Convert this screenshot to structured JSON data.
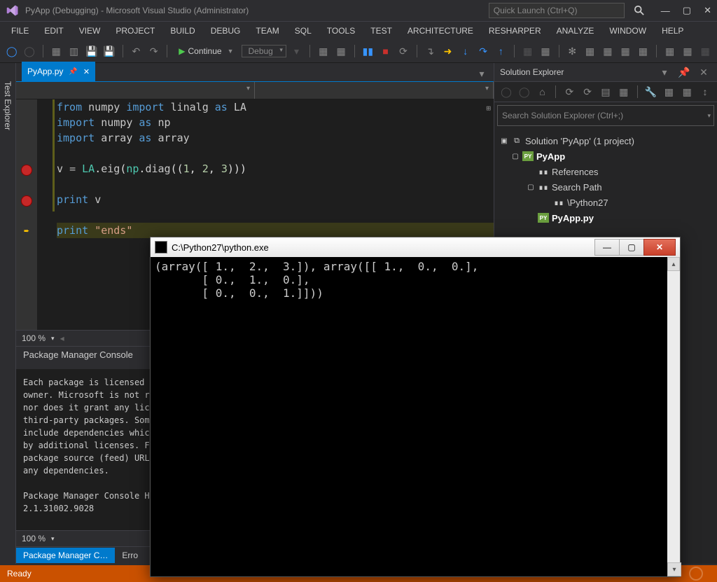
{
  "window": {
    "title": "PyApp (Debugging) - Microsoft Visual Studio (Administrator)",
    "quick_launch_placeholder": "Quick Launch (Ctrl+Q)"
  },
  "menu": [
    "FILE",
    "EDIT",
    "VIEW",
    "PROJECT",
    "BUILD",
    "DEBUG",
    "TEAM",
    "SQL",
    "TOOLS",
    "TEST",
    "ARCHITECTURE",
    "RESHARPER",
    "ANALYZE",
    "WINDOW",
    "HELP"
  ],
  "toolbar": {
    "continue": "Continue",
    "config": "Debug"
  },
  "left_rail": {
    "test_explorer": "Test Explorer"
  },
  "editor": {
    "tab_name": "PyApp.py",
    "zoom": "100 %",
    "code": {
      "l1": {
        "a": "from ",
        "b": "numpy ",
        "c": "import ",
        "d": "linalg ",
        "e": "as ",
        "f": "LA"
      },
      "l2": {
        "a": "import ",
        "b": "numpy ",
        "c": "as ",
        "d": "np"
      },
      "l3": {
        "a": "import ",
        "b": "array ",
        "c": "as ",
        "d": "array"
      },
      "l5": {
        "a": "v ",
        "b": "= ",
        "c": "LA",
        "d": ".",
        "e": "eig",
        "f": "(",
        "g": "np",
        "h": ".",
        "i": "diag",
        "j": "((",
        "k": "1",
        "l": ", ",
        "m": "2",
        "n": ", ",
        "o": "3",
        "p": ")))"
      },
      "l7": {
        "a": "print ",
        "b": "v"
      },
      "l9": {
        "a": "print ",
        "b": "\"ends\""
      }
    }
  },
  "pmc": {
    "title": "Package Manager Console",
    "body": "Each package is licensed to you by its\nowner. Microsoft is not responsible for,\n nor does it grant any licenses to,\nthird-party packages. Some packages may\ninclude dependencies which are governed\nby additional licenses. Follow the\npackage source (feed) URL to determine\nany dependencies.\n\nPackage Manager Console Host Version\n2.1.31002.9028",
    "zoom": "100 %",
    "tabs": [
      "Package Manager C…",
      "Erro"
    ]
  },
  "solution": {
    "title": "Solution Explorer",
    "search_placeholder": "Search Solution Explorer (Ctrl+;)",
    "root": "Solution 'PyApp' (1 project)",
    "items": [
      {
        "label": "PyApp",
        "icon": "PY",
        "bold": true,
        "indent": 1,
        "exp": "▢"
      },
      {
        "label": "References",
        "icon": "∎∎",
        "indent": 2
      },
      {
        "label": "Search Path",
        "icon": "∎∎",
        "indent": 2,
        "exp": "▢"
      },
      {
        "label": "\\Python27",
        "icon": "∎∎",
        "indent": 3
      },
      {
        "label": "PyApp.py",
        "icon": "PY",
        "bold": true,
        "indent": 2
      }
    ]
  },
  "status": {
    "text": "Ready"
  },
  "console": {
    "title": "C:\\Python27\\python.exe",
    "output": "(array([ 1.,  2.,  3.]), array([[ 1.,  0.,  0.],\n       [ 0.,  1.,  0.],\n       [ 0.,  0.,  1.]]))"
  }
}
